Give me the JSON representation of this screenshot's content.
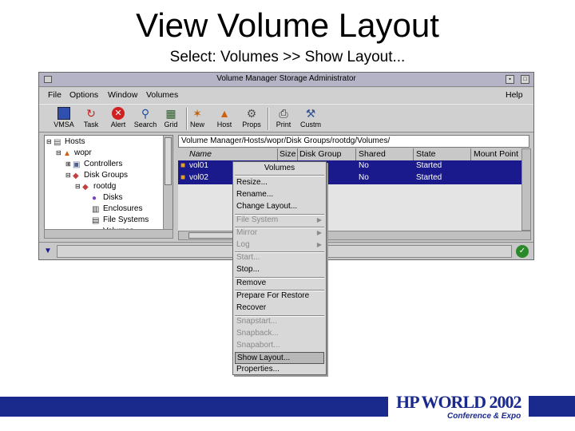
{
  "slide": {
    "title": "View Volume Layout",
    "subtitle": "Select: Volumes >> Show Layout..."
  },
  "window": {
    "title": "Volume Manager Storage Administrator",
    "menu": [
      "File",
      "Options",
      "Window",
      "Volumes"
    ],
    "help": "Help",
    "toolbar": [
      {
        "label": "VMSA",
        "icon": "vmsa-icon"
      },
      {
        "label": "Task",
        "icon": "task-icon"
      },
      {
        "label": "Alert",
        "icon": "alert-icon"
      },
      {
        "label": "Search",
        "icon": "search-icon"
      },
      {
        "label": "Grid",
        "icon": "grid-icon"
      },
      {
        "label": "New",
        "icon": "new-icon"
      },
      {
        "label": "Host",
        "icon": "host-icon"
      },
      {
        "label": "Props",
        "icon": "props-icon"
      },
      {
        "label": "Print",
        "icon": "print-icon"
      },
      {
        "label": "Custm",
        "icon": "customize-icon"
      }
    ]
  },
  "tree": {
    "items": [
      {
        "label": "Hosts",
        "icon": "hosts-icon"
      },
      {
        "label": "wopr",
        "icon": "host-icon"
      },
      {
        "label": "Controllers",
        "icon": "controllers-icon"
      },
      {
        "label": "Disk Groups",
        "icon": "disk-groups-icon"
      },
      {
        "label": "rootdg",
        "icon": "disk-group-icon"
      },
      {
        "label": "Disks",
        "icon": "disks-icon"
      },
      {
        "label": "Enclosures",
        "icon": "enclosures-icon"
      },
      {
        "label": "File Systems",
        "icon": "file-systems-icon"
      },
      {
        "label": "Volumes",
        "icon": "volumes-icon"
      }
    ]
  },
  "grid": {
    "path": "Volume Manager/Hosts/wopr/Disk Groups/rootdg/Volumes/",
    "columns": [
      "Name",
      "Size",
      "Disk Group",
      "Shared",
      "State",
      "Mount Point"
    ],
    "rows": [
      {
        "name": "vol01",
        "shared": "No",
        "state": "Started"
      },
      {
        "name": "vol02",
        "shared": "No",
        "state": "Started"
      }
    ]
  },
  "context_menu": {
    "title": "Volumes",
    "items": [
      {
        "label": "Resize...",
        "enabled": true
      },
      {
        "label": "Rename...",
        "enabled": true
      },
      {
        "label": "Change Layout...",
        "enabled": true
      },
      {
        "label": "File System",
        "enabled": false,
        "submenu": true
      },
      {
        "label": "Mirror",
        "enabled": false,
        "submenu": true
      },
      {
        "label": "Log",
        "enabled": false,
        "submenu": true
      },
      {
        "label": "Start...",
        "enabled": false
      },
      {
        "label": "Stop...",
        "enabled": true
      },
      {
        "label": "Remove",
        "enabled": true
      },
      {
        "label": "Prepare For Restore",
        "enabled": true
      },
      {
        "label": "Recover",
        "enabled": true
      },
      {
        "label": "Snapstart...",
        "enabled": false
      },
      {
        "label": "Snapback...",
        "enabled": false
      },
      {
        "label": "Snapabort...",
        "enabled": false
      },
      {
        "label": "Show Layout...",
        "enabled": true,
        "selected": true
      },
      {
        "label": "Properties...",
        "enabled": true
      }
    ]
  },
  "footer": {
    "logo_text": "HP WORLD 2002",
    "logo_sub": "Conference & Expo",
    "brand_color": "#1a2a8c"
  },
  "colors": {
    "selection": "#1a1a8c",
    "window_bg": "#c8c8c8",
    "titlebar": "#b4b4c6"
  }
}
